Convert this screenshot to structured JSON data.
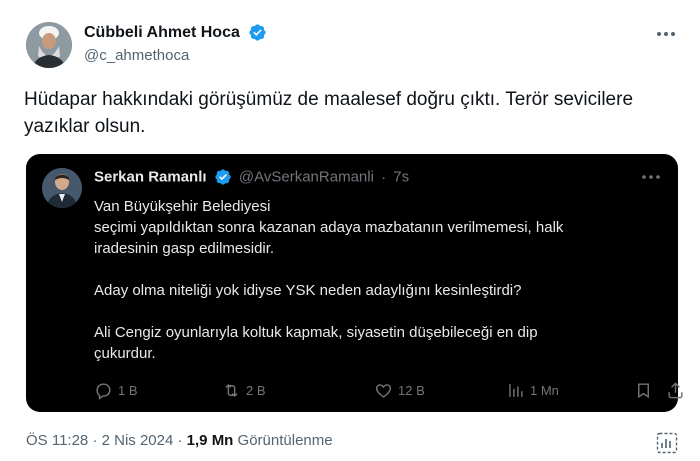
{
  "author": {
    "name": "Cübbeli Ahmet Hoca",
    "handle": "@c_ahmethoca"
  },
  "tweet": {
    "text": "Hüdapar hakkındaki görüşümüz de maalesef doğru çıktı. Terör sevicilere yazıklar olsun."
  },
  "quote": {
    "name": "Serkan Ramanlı",
    "handle": "@AvSerkanRamanli",
    "separator": "·",
    "time": "7s",
    "lines": {
      "l1": "Van Büyükşehir Belediyesi",
      "l2": "seçimi yapıldıktan sonra kazanan adaya mazbatanın verilmemesi, halk",
      "l3": "iradesinin gasp edilmesidir.",
      "l4": "Aday olma niteliği yok idiyse YSK neden adaylığını kesinleştirdi?",
      "l5": "Ali Cengiz oyunlarıyla koltuk kapmak, siyasetin düşebileceği en dip",
      "l6": "çukurdur."
    },
    "actions": {
      "replies": "1 B",
      "retweets": "2 B",
      "likes": "12 B",
      "views": "1 Mn"
    }
  },
  "meta": {
    "time": "ÖS 11:28",
    "sep1": "·",
    "date": "2 Nis 2024",
    "sep2": "·",
    "views_count": "1,9 Mn",
    "views_label": "Görüntülenme"
  },
  "colors": {
    "verified_blue": "#1d9bf0",
    "quote_bg": "#000000",
    "secondary_text": "#536471"
  }
}
